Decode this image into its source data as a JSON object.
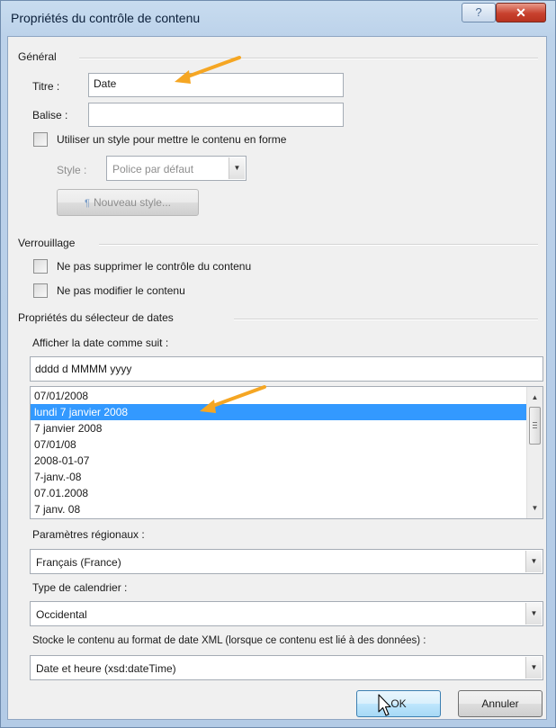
{
  "window": {
    "title": "Propriétés du contrôle de contenu",
    "help_label": "?",
    "close_label": "✕"
  },
  "general": {
    "section_label": "Général",
    "title_label": "Titre :",
    "title_value": "Date",
    "tag_label": "Balise :",
    "tag_value": "",
    "use_style_label": "Utiliser un style pour mettre le contenu en forme",
    "use_style_checked": false,
    "style_label": "Style :",
    "style_value": "Police par défaut",
    "new_style_label": "Nouveau style..."
  },
  "locking": {
    "section_label": "Verrouillage",
    "no_delete_label": "Ne pas supprimer le contrôle du contenu",
    "no_delete_checked": false,
    "no_edit_label": "Ne pas modifier le contenu",
    "no_edit_checked": false
  },
  "date_picker": {
    "section_label": "Propriétés du sélecteur de dates",
    "display_label": "Afficher la date comme suit :",
    "format_value": "dddd d MMMM yyyy",
    "formats": [
      "07/01/2008",
      "lundi 7 janvier 2008",
      "7 janvier 2008",
      "07/01/08",
      "2008-01-07",
      "7-janv.-08",
      "07.01.2008",
      "7 janv. 08"
    ],
    "selected_index": 1,
    "locale_label": "Paramètres régionaux :",
    "locale_value": "Français (France)",
    "calendar_label": "Type de calendrier :",
    "calendar_value": "Occidental",
    "xml_label": "Stocke le contenu au format de date XML (lorsque ce contenu est lié à des données) :",
    "xml_value": "Date et heure (xsd:dateTime)"
  },
  "buttons": {
    "ok": "OK",
    "cancel": "Annuler"
  },
  "colors": {
    "selection": "#3399ff",
    "annotation_arrow": "#f5a623"
  }
}
